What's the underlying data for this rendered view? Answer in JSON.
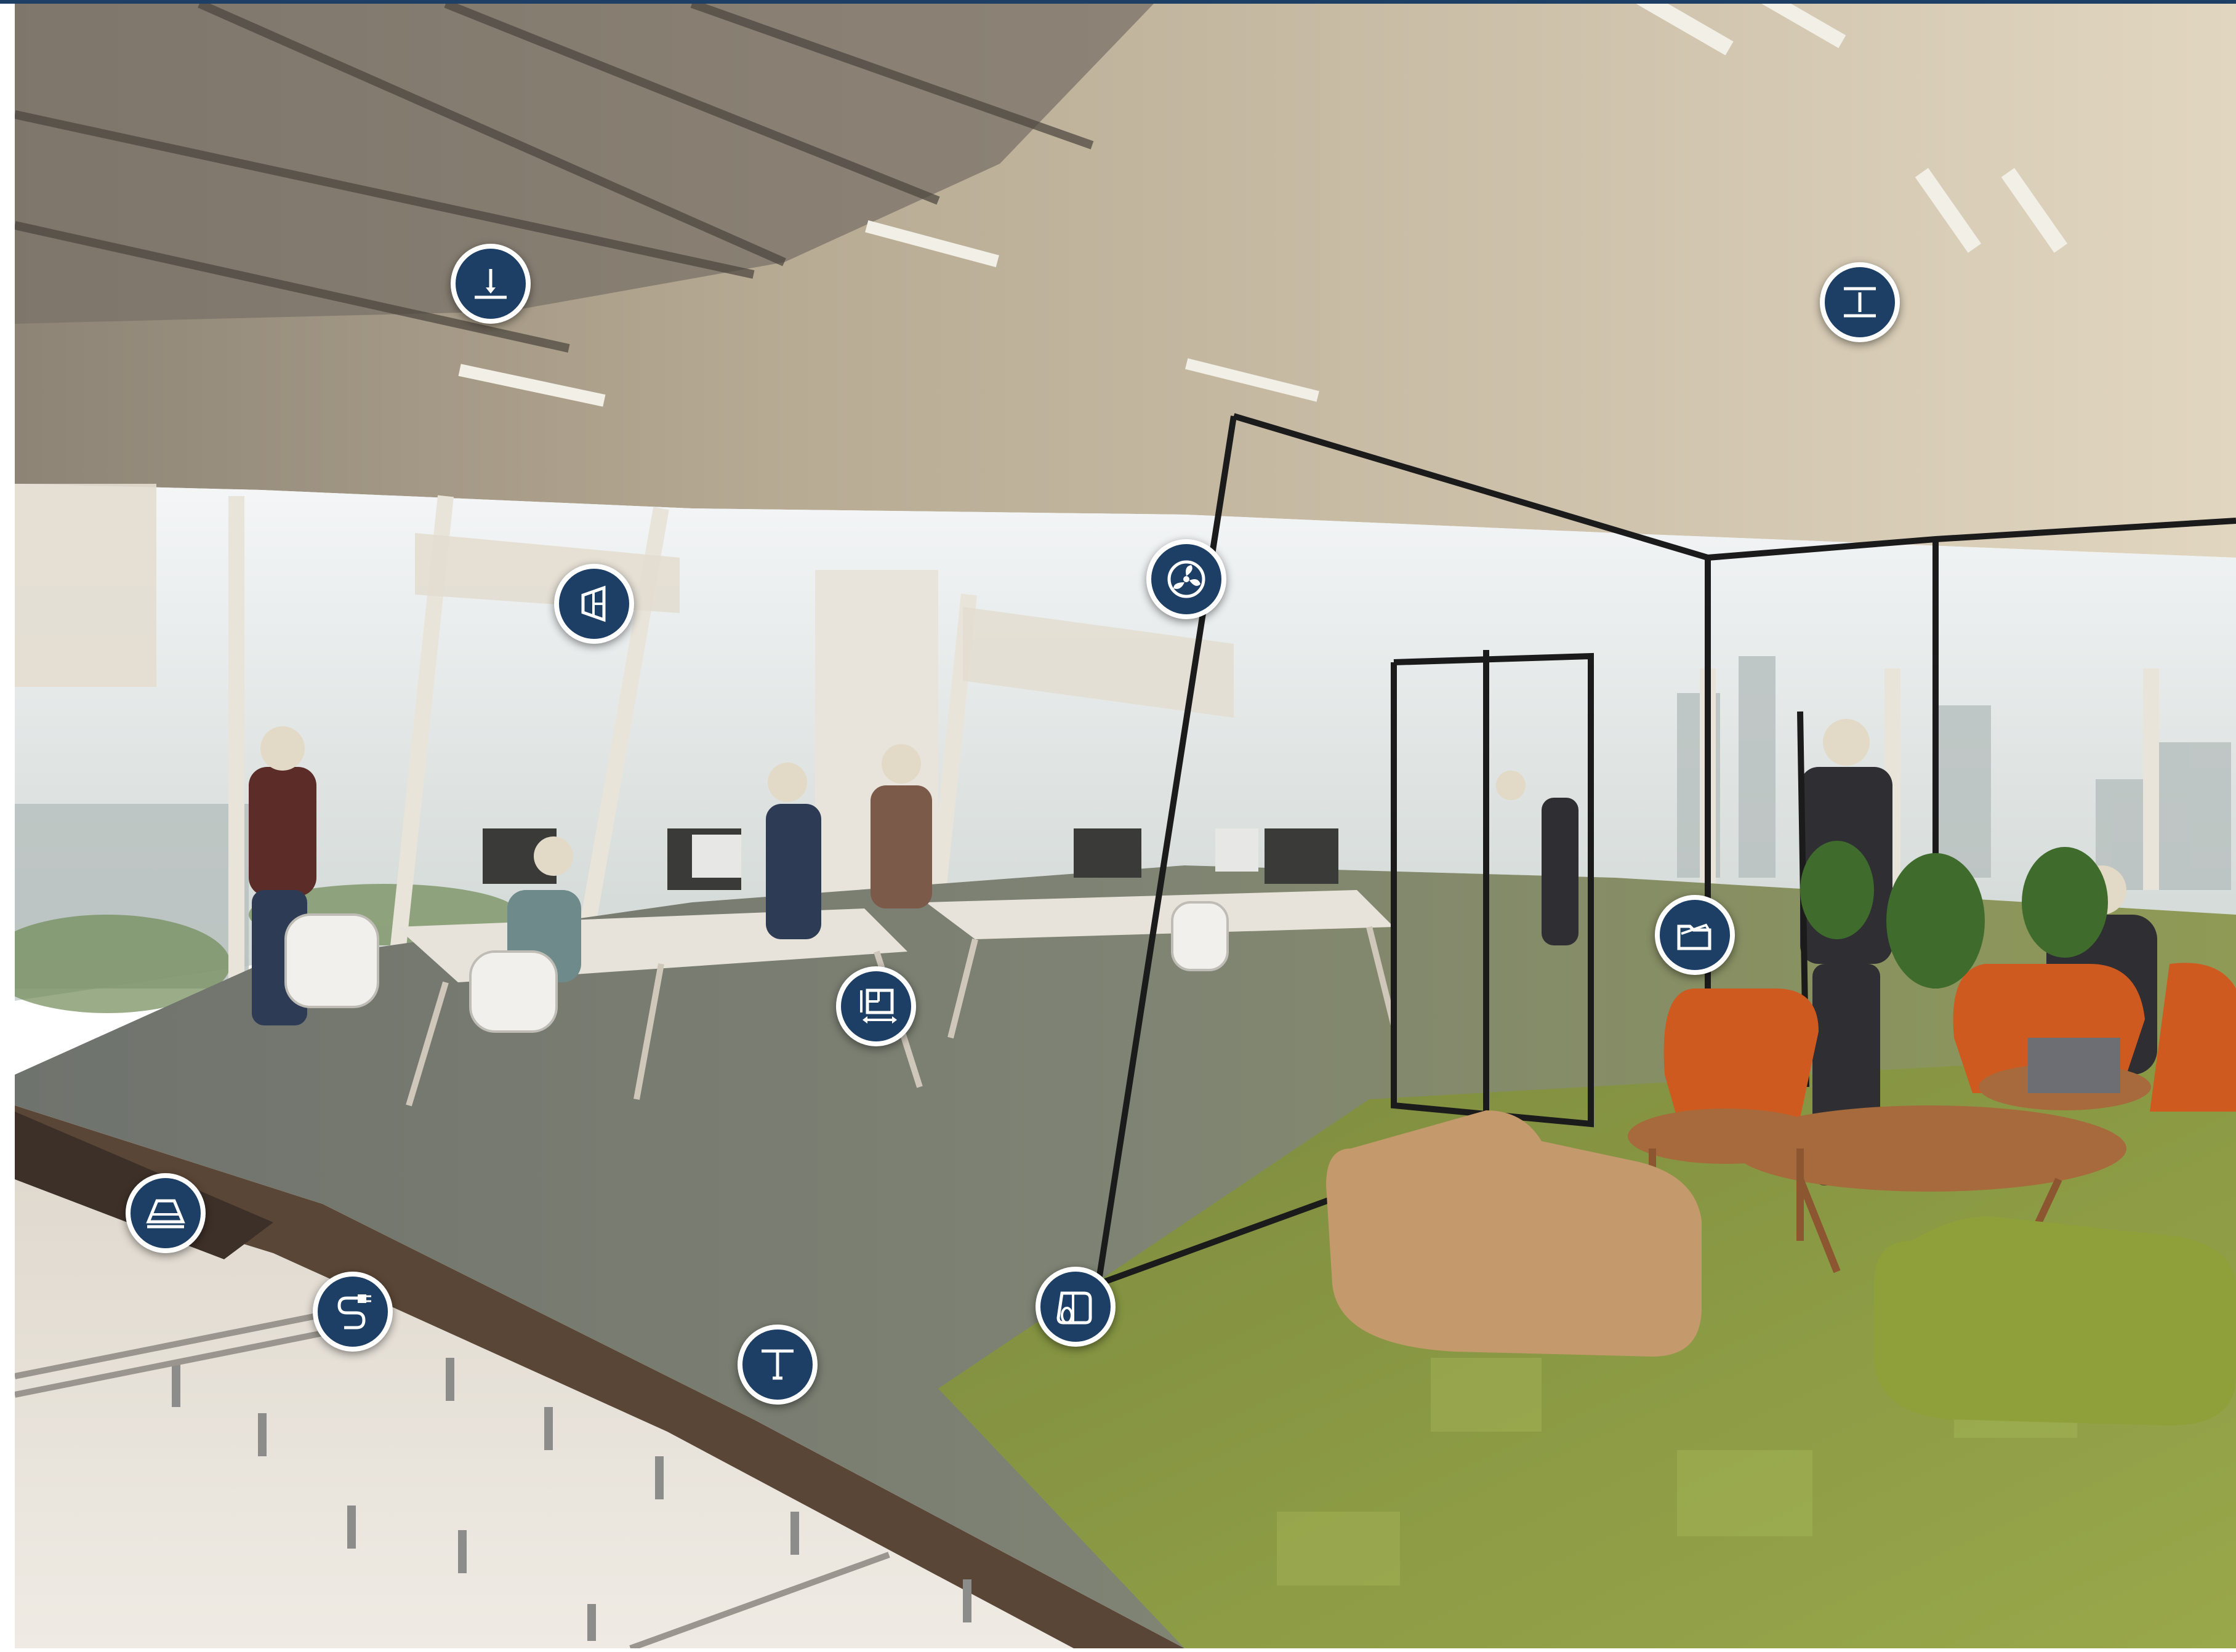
{
  "frame": {
    "border_color": "#1d3f66",
    "background": "#ffffff"
  },
  "scene": {
    "description_icon": "office-interior-photo",
    "palette": {
      "ceiling": "#d9ccb2",
      "ceiling_shadow": "#9e917b",
      "window_light": "#eef1f2",
      "carpet_grey": "#7d8077",
      "carpet_green": "#8e9a4a",
      "raised_floor": "#5a4636",
      "subfloor": "#e6e1d9",
      "glass_frame": "#1b1b1b",
      "chair_orange": "#d05a22",
      "pouf_tan": "#c49a6c",
      "pouf_green": "#8fa03a"
    }
  },
  "hotspot_style": {
    "fill": "#1d3f66",
    "stroke": "#ffffff"
  },
  "hotspots": [
    {
      "name": "suspended-ceiling-hanger-hotspot",
      "icon": "ceiling-hanger-icon"
    },
    {
      "name": "ceiling-panel-hotspot",
      "icon": "ceiling-panel-icon"
    },
    {
      "name": "window-acoustic-hotspot",
      "icon": "window-panel-icon"
    },
    {
      "name": "ventilation-fan-hotspot",
      "icon": "fan-icon"
    },
    {
      "name": "floor-plan-hotspot",
      "icon": "floor-plan-icon"
    },
    {
      "name": "furniture-folder-hotspot",
      "icon": "folder-icon"
    },
    {
      "name": "floor-box-hotspot",
      "icon": "floor-box-icon"
    },
    {
      "name": "power-cable-hotspot",
      "icon": "power-cable-icon"
    },
    {
      "name": "floor-pedestal-hotspot",
      "icon": "pedestal-icon"
    },
    {
      "name": "carpet-roll-hotspot",
      "icon": "carpet-roll-icon"
    }
  ]
}
